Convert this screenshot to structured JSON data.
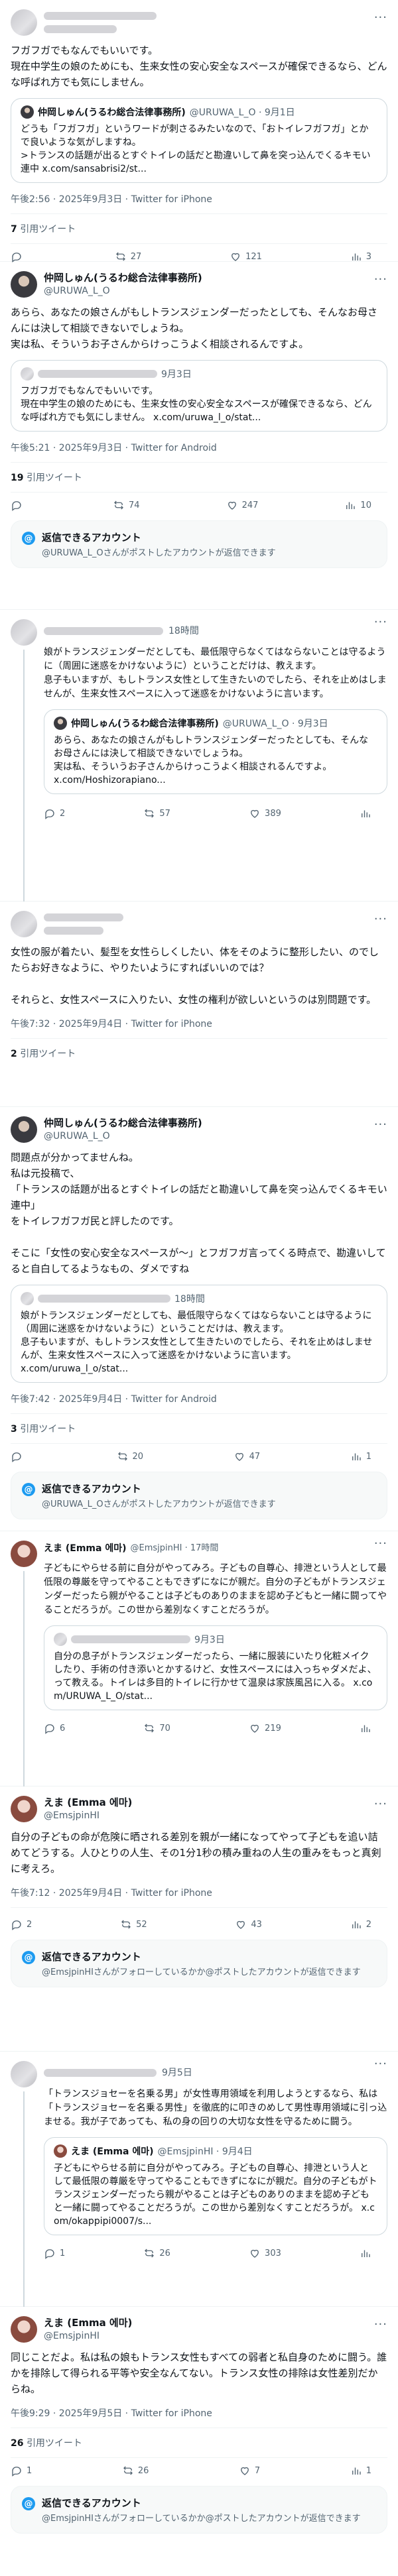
{
  "posts": [
    {
      "id": "p1",
      "body": "フガフガでもなんでもいいです。\n現在中学生の娘のためにも、生来女性の安心安全なスペースが確保できるなら、どんな呼ばれ方でも気にしません。",
      "quote": {
        "display_name": "仲岡しゅん(うるわ総合法律事務所)",
        "handle": "@URUWA_L_O · 9月1日",
        "body": "どうも「フガフガ」というワードが刺さるみたいなので、「おトイレフガフガ」とかで良いような気がしますね。\n>トランスの話題が出るとすぐトイレの話だと勘違いして鼻を突っ込んでくるキモい連中 x.com/sansabrisi2/st..."
      },
      "meta": "午後2:56 · 2025年9月3日 · Twitter for iPhone",
      "quote_count": "7",
      "quote_label": "引用ツイート",
      "actions": {
        "reply": "",
        "retweet": "27",
        "like": "121",
        "views": "3"
      }
    },
    {
      "id": "p2",
      "display_name": "仲岡しゅん(うるわ総合法律事務所)",
      "handle": "@URUWA_L_O",
      "body": "あらら、あなたの娘さんがもしトランスジェンダーだったとしても、そんなお母さんには決して相談できないでしょうね。\n実は私、そういうお子さんからけっこうよく相談されるんですよ。",
      "quote": {
        "handle": "9月3日",
        "body": "フガフガでもなんでもいいです。\n現在中学生の娘のためにも、生来女性の安心安全なスペースが確保できるなら、どんな呼ばれ方でも気にしません。 x.com/uruwa_l_o/stat..."
      },
      "meta": "午後5:21 · 2025年9月3日 · Twitter for Android",
      "quote_count": "19",
      "quote_label": "引用ツイート",
      "actions": {
        "reply": "",
        "retweet": "74",
        "like": "247",
        "views": "10"
      },
      "notice": {
        "title": "返信できるアカウント",
        "desc": "@URUWA_L_Oさんがポストしたアカウントが返信できます"
      }
    },
    {
      "id": "p3",
      "handle": "18時間",
      "body": "娘がトランスジェンダーだとしても、最低限守らなくてはならないことは守るように（周囲に迷惑をかけないように）ということだけは、教えます。\n息子もいますが、もしトランス女性として生きたいのでしたら、それを止めはしませんが、生来女性スペースに入って迷惑をかけないように言います。",
      "quote": {
        "display_name": "仲岡しゅん(うるわ総合法律事務所)",
        "handle": "@URUWA_L_O · 9月3日",
        "body": "あらら、あなたの娘さんがもしトランスジェンダーだったとしても、そんなお母さんには決して相談できないでしょうね。\n実は私、そういうお子さんからけっこうよく相談されるんですよ。\nx.com/Hoshizorapiano..."
      },
      "actions": {
        "reply": "2",
        "retweet": "57",
        "like": "389",
        "views": ""
      }
    },
    {
      "id": "p4",
      "body": "女性の服が着たい、髪型を女性らしくしたい、体をそのように整形したい、のでしたらお好きなように、やりたいようにすればいいのでは？\n\nそれらと、女性スペースに入りたい、女性の権利が欲しいというのは別問題です。",
      "meta": "午後7:32 · 2025年9月4日 · Twitter for iPhone",
      "quote_count": "2",
      "quote_label": "引用ツイート"
    },
    {
      "id": "p5",
      "display_name": "仲岡しゅん(うるわ総合法律事務所)",
      "handle": "@URUWA_L_O",
      "body": "問題点が分かってませんね。\n私は元投稿で、\n「トランスの話題が出るとすぐトイレの話だと勘違いして鼻を突っ込んでくるキモい連中」\nをトイレフガフガ民と評したのです。\n\nそこに「女性の安心安全なスペースが〜」とフガフガ言ってくる時点で、勘違いしてると自白してるようなもの、ダメですね",
      "quote": {
        "handle": "18時間",
        "body": "娘がトランスジェンダーだとしても、最低限守らなくてはならないことは守るように（周囲に迷惑をかけないように）ということだけは、教えます。\n息子もいますが、もしトランス女性として生きたいのでしたら、それを止めはしませんが、生来女性スペースに入って迷惑をかけないように言います。\nx.com/uruwa_l_o/stat..."
      },
      "meta": "午後7:42 · 2025年9月4日 · Twitter for Android",
      "quote_count": "3",
      "quote_label": "引用ツイート",
      "actions": {
        "reply": "",
        "retweet": "20",
        "like": "47",
        "views": "1"
      },
      "notice": {
        "title": "返信できるアカウント",
        "desc": "@URUWA_L_Oさんがポストしたアカウントが返信できます"
      }
    },
    {
      "id": "p6",
      "display_name": "えま (Emma 에마)",
      "handle": "@EmsjpinHI · 17時間",
      "body": "子どもにやらせる前に自分がやってみろ。子どもの自尊心、排泄という人として最低限の尊厳を守ってやることもできずになにが親だ。自分の子どもがトランスジェンダーだったら親がやることは子どものありのままを認め子どもと一緒に闘ってやることだろうが。この世から差別なくすことだろうが。",
      "quote": {
        "handle": "9月3日",
        "body": "自分の息子がトランスジェンダーだったら、一緒に服装にいたり化粧メイクしたり、手術の付き添いとかするけど、女性スペースには入っちゃダメだよ、って教える。トイレは多目的トイレに行かせて温泉は家族風呂に入る。 x.com/URUWA_L_O/stat..."
      },
      "actions": {
        "reply": "6",
        "retweet": "70",
        "like": "219",
        "views": ""
      }
    },
    {
      "id": "p7",
      "display_name": "えま (Emma 에마)",
      "handle": "@EmsjpinHI",
      "body": "自分の子どもの命が危険に晒される差別を親が一緒になってやって子どもを追い詰めてどうする。人ひとりの人生、その1分1秒の積み重ねの人生の重みをもっと真剣に考えろ。",
      "meta": "午後7:12 · 2025年9月4日 · Twitter for iPhone",
      "actions": {
        "reply": "2",
        "retweet": "52",
        "like": "43",
        "views": "2"
      },
      "notice": {
        "title": "返信できるアカウント",
        "desc": "@EmsjpinHIさんがフォローしているかか@ポストしたアカウントが返信できます"
      }
    },
    {
      "id": "p8",
      "handle": "9月5日",
      "body": "「トランスジョセーを名乗る男」が女性専用領域を利用しようとするなら、私は「トランスジョセーを名乗る男性」を徹底的に叩きのめして男性専用領域に引っ込ませる。我が子であっても、私の身の回りの大切な女性を守るために闘う。",
      "quote": {
        "display_name": "えま (Emma 에마)",
        "handle": "@EmsjpinHI · 9月4日",
        "body": "子どもにやらせる前に自分がやってみろ。子どもの自尊心、排泄という人として最低限の尊厳を守ってやることもできずになにが親だ。自分の子どもがトランスジェンダーだったら親がやることは子どものありのままを認め子どもと一緒に闘ってやることだろうが。この世から差別なくすことだろうが。 x.com/okappipi0007/s..."
      },
      "actions": {
        "reply": "1",
        "retweet": "26",
        "like": "303",
        "views": ""
      }
    },
    {
      "id": "p9",
      "display_name": "えま (Emma 에마)",
      "handle": "@EmsjpinHI",
      "body": "同じことだよ。私は私の娘もトランス女性もすべての弱者と私自身のために闘う。誰かを排除して得られる平等や安全なんてない。トランス女性の排除は女性差別だからね。",
      "meta": "午後9:29 · 2025年9月5日 · Twitter for iPhone",
      "quote_count": "26",
      "quote_label": "引用ツイート",
      "actions": {
        "reply": "1",
        "retweet": "26",
        "like": "7",
        "views": "1"
      },
      "notice": {
        "title": "返信できるアカウント",
        "desc": "@EmsjpinHIさんがフォローしているかか@ポストしたアカウントが返信できます"
      }
    }
  ]
}
